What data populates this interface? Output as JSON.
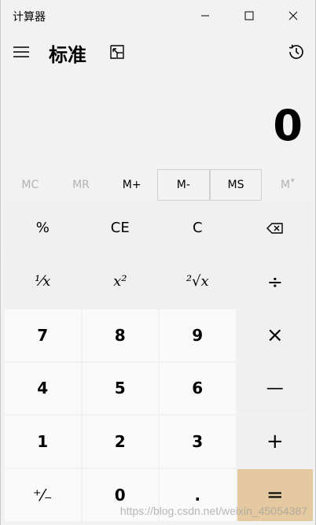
{
  "window": {
    "title": "计算器"
  },
  "header": {
    "mode": "标准"
  },
  "display": {
    "value": "0"
  },
  "memory": {
    "mc": "MC",
    "mr": "MR",
    "mplus": "M+",
    "mminus": "M-",
    "ms": "MS",
    "mview": "M"
  },
  "keys": {
    "percent": "%",
    "ce": "CE",
    "c": "C",
    "reciprocal": "¹⁄x",
    "square": "x²",
    "sqrt": "²√x",
    "divide": "÷",
    "seven": "7",
    "eight": "8",
    "nine": "9",
    "multiply": "×",
    "four": "4",
    "five": "5",
    "six": "6",
    "minus": "—",
    "one": "1",
    "two": "2",
    "three": "3",
    "plus": "+",
    "negate": "⁺⁄₋",
    "zero": "0",
    "decimal": ".",
    "equals": "="
  },
  "watermark": "https://blog.csdn.net/weixin_45054387",
  "colors": {
    "equals_bg": "#e4c9a1",
    "number_bg": "#fafafa",
    "function_bg": "#f0f0f0",
    "disabled_text": "#b3b3b3"
  }
}
